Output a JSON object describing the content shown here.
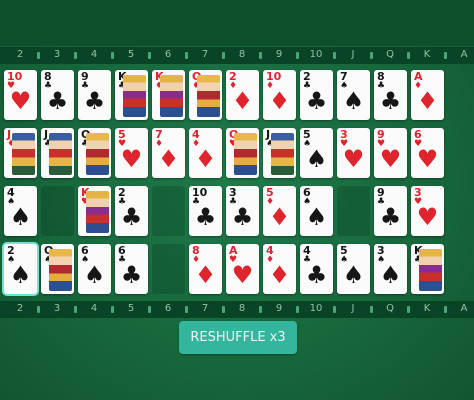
{
  "ranks": [
    "2",
    "3",
    "4",
    "5",
    "6",
    "7",
    "8",
    "9",
    "10",
    "J",
    "Q",
    "K",
    "A"
  ],
  "reshuffle_label": "RESHUFFLE x3",
  "colors": {
    "felt": "#17663b",
    "button": "#33b69d",
    "selection": "#6fe4d4",
    "red_suit": "#e0242d",
    "black_suit": "#161616"
  },
  "rows": [
    [
      {
        "rank": "10",
        "suit": "♥",
        "color": "red"
      },
      {
        "rank": "8",
        "suit": "♣",
        "color": "black"
      },
      {
        "rank": "9",
        "suit": "♣",
        "color": "black"
      },
      {
        "rank": "K",
        "suit": "♣",
        "color": "black",
        "face": true
      },
      {
        "rank": "K",
        "suit": "♦",
        "color": "red",
        "face": true
      },
      {
        "rank": "Q",
        "suit": "♦",
        "color": "red",
        "face": true
      },
      {
        "rank": "2",
        "suit": "♦",
        "color": "red"
      },
      {
        "rank": "10",
        "suit": "♦",
        "color": "red"
      },
      {
        "rank": "2",
        "suit": "♣",
        "color": "black"
      },
      {
        "rank": "7",
        "suit": "♠",
        "color": "black"
      },
      {
        "rank": "8",
        "suit": "♣",
        "color": "black"
      },
      {
        "rank": "A",
        "suit": "♦",
        "color": "red"
      },
      {
        "rank": "9",
        "suit": "♠",
        "color": "black"
      }
    ],
    [
      {
        "rank": "J",
        "suit": "♦",
        "color": "red",
        "face": true
      },
      {
        "rank": "J",
        "suit": "♣",
        "color": "black",
        "face": true
      },
      {
        "rank": "Q",
        "suit": "♣",
        "color": "black",
        "face": true
      },
      {
        "rank": "5",
        "suit": "♥",
        "color": "red"
      },
      {
        "rank": "7",
        "suit": "♦",
        "color": "red"
      },
      {
        "rank": "4",
        "suit": "♦",
        "color": "red"
      },
      {
        "rank": "Q",
        "suit": "♥",
        "color": "red",
        "face": true
      },
      {
        "rank": "J",
        "suit": "♠",
        "color": "black",
        "face": true
      },
      {
        "rank": "5",
        "suit": "♠",
        "color": "black"
      },
      {
        "rank": "3",
        "suit": "♥",
        "color": "red"
      },
      {
        "rank": "9",
        "suit": "♥",
        "color": "red"
      },
      {
        "rank": "6",
        "suit": "♥",
        "color": "red"
      },
      {
        "rank": "7",
        "suit": "♥",
        "color": "red"
      }
    ],
    [
      {
        "rank": "4",
        "suit": "♠",
        "color": "black"
      },
      null,
      {
        "rank": "K",
        "suit": "♥",
        "color": "red",
        "face": true
      },
      {
        "rank": "2",
        "suit": "♣",
        "color": "black"
      },
      null,
      {
        "rank": "10",
        "suit": "♣",
        "color": "black"
      },
      {
        "rank": "3",
        "suit": "♣",
        "color": "black"
      },
      {
        "rank": "5",
        "suit": "♦",
        "color": "red"
      },
      {
        "rank": "6",
        "suit": "♠",
        "color": "black"
      },
      null,
      {
        "rank": "9",
        "suit": "♣",
        "color": "black"
      },
      {
        "rank": "3",
        "suit": "♥",
        "color": "red"
      },
      {
        "rank": "K",
        "suit": "♠",
        "color": "black",
        "face": true
      }
    ],
    [
      {
        "rank": "2",
        "suit": "♠",
        "color": "black",
        "selected": true
      },
      {
        "rank": "Q",
        "suit": "♠",
        "color": "black",
        "face": true
      },
      {
        "rank": "6",
        "suit": "♠",
        "color": "black"
      },
      {
        "rank": "6",
        "suit": "♣",
        "color": "black"
      },
      null,
      {
        "rank": "8",
        "suit": "♦",
        "color": "red"
      },
      {
        "rank": "A",
        "suit": "♥",
        "color": "red"
      },
      {
        "rank": "4",
        "suit": "♦",
        "color": "red"
      },
      {
        "rank": "4",
        "suit": "♣",
        "color": "black"
      },
      {
        "rank": "5",
        "suit": "♠",
        "color": "black"
      },
      {
        "rank": "3",
        "suit": "♠",
        "color": "black"
      },
      {
        "rank": "K",
        "suit": "♣",
        "color": "black",
        "face": true
      },
      {
        "rank": "8",
        "suit": "♠",
        "color": "black"
      }
    ]
  ]
}
